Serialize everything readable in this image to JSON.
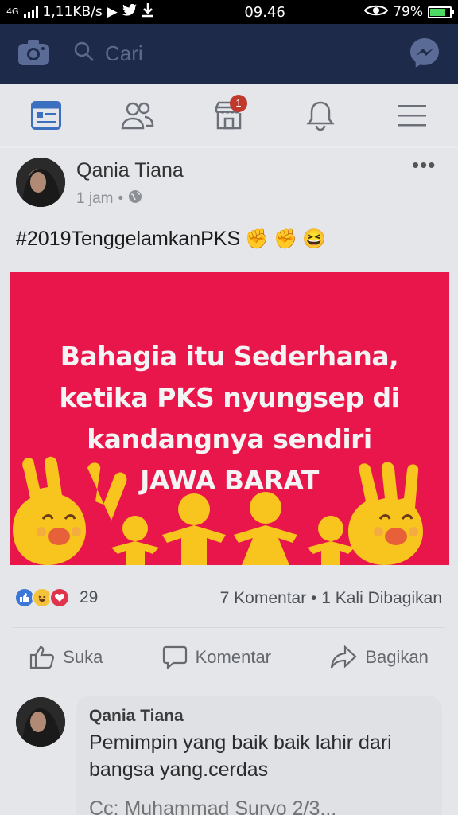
{
  "status_bar": {
    "network_label": "4G",
    "speed": "1,11KB/s",
    "time": "09.46",
    "battery_percent": "79%",
    "battery_level": 0.79
  },
  "top_bar": {
    "search_placeholder": "Cari"
  },
  "nav": {
    "marketplace_badge": "1"
  },
  "post": {
    "author": "Qania Tiana",
    "time": "1 jam",
    "privacy_icon": "globe-icon",
    "more_label": "•••",
    "hashtag": "#2019TenggelamkanPKS",
    "emojis": [
      "✊",
      "✊",
      "😆"
    ],
    "image": {
      "lines": [
        "Bahagia itu Sederhana,",
        "ketika PKS nyungsep di",
        "kandangnya sendiri",
        "JAWA BARAT"
      ],
      "background": "#e8164a",
      "figure_color": "#f7c51e"
    },
    "reaction_count": "29",
    "comments_shares": "7 Komentar • 1 Kali Dibagikan",
    "actions": {
      "like": "Suka",
      "comment": "Komentar",
      "share": "Bagikan"
    }
  },
  "comment": {
    "author": "Qania Tiana",
    "text": "Pemimpin yang baik baik lahir dari bangsa yang.cerdas",
    "next_line": "Cc: Muhammad Suryo 2/3..."
  },
  "colors": {
    "top_bar": "#1d2a4a",
    "like_blue": "#3b76d8",
    "love_red": "#e0344c",
    "haha_yellow": "#f5c33b"
  }
}
